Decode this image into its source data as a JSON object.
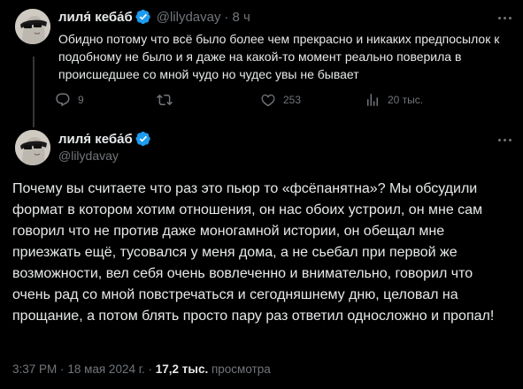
{
  "tweet1": {
    "author_name": "лиля́ кеба́б",
    "author_handle": "@lilydavay",
    "separator": "·",
    "time": "8 ч",
    "text": "Обидно потому что всё было более чем прекрасно и никаких предпосылок к подобному не было и я даже на какой-то момент реально поверила в происшедшее со мной чудо но чудес увы не бывает",
    "replies": "9",
    "likes": "253",
    "views": "20 тыс."
  },
  "tweet2": {
    "author_name": "лиля́ кеба́б",
    "author_handle": "@lilydavay",
    "text": "Почему вы считаете что раз это пьюр то «фсёпанятна»? Мы обсудили формат в котором хотим отношения, он нас обоих устроил, он мне сам говорил что не против даже моногамной истории, он обещал мне приезжать ещё, тусовался у меня дома, а не сьебал при первой же возможности, вел себя очень вовлеченно и внимательно, говорил что очень рад со мной повстречаться и сегодняшнему дню, целовал на прощание, а потом блять просто пару раз ответил односложно и пропал!",
    "time": "3:37 PM",
    "date": "18 мая 2024 г.",
    "separator": "·",
    "views_count": "17,2 тыс.",
    "views_label": "просмотра"
  },
  "colors": {
    "background": "#000000",
    "text": "#e7e9ea",
    "secondary": "#71767b",
    "verified": "#1d9bf0"
  },
  "icons": [
    "verified-badge-icon",
    "more-icon",
    "reply-icon",
    "retweet-icon",
    "like-icon",
    "views-icon"
  ]
}
